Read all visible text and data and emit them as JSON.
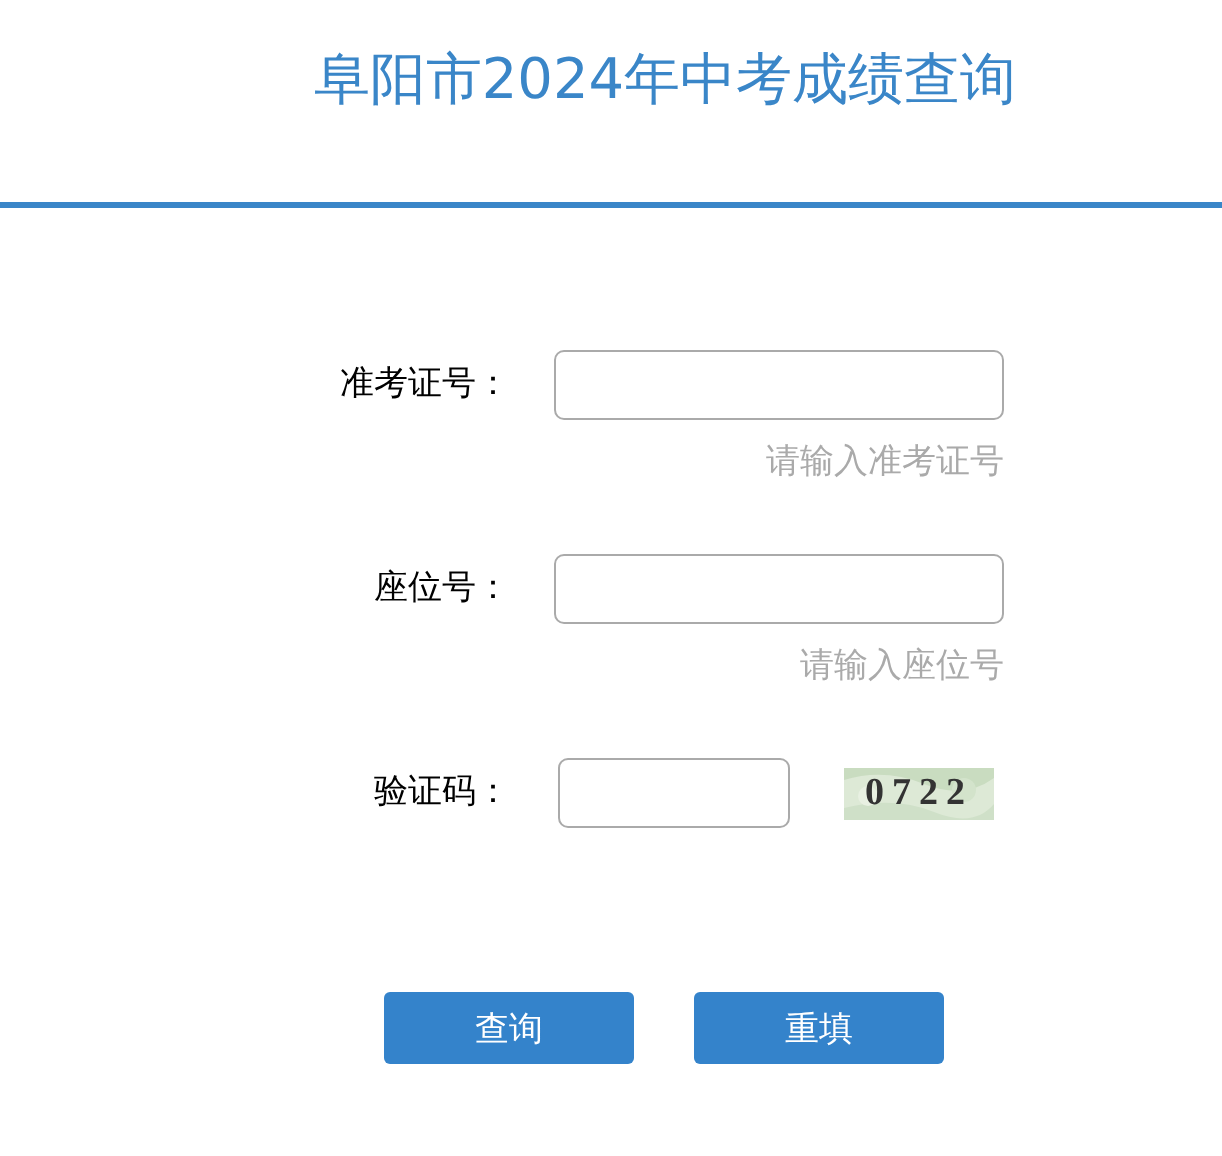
{
  "title": "阜阳市2024年中考成绩查询",
  "fields": [
    {
      "label": "准考证号：",
      "hint": "请输入准考证号"
    },
    {
      "label": "座位号：",
      "hint": "请输入座位号"
    }
  ],
  "captcha": {
    "label": "验证码：",
    "code": "0722"
  },
  "buttons": [
    "查询",
    "重填"
  ]
}
